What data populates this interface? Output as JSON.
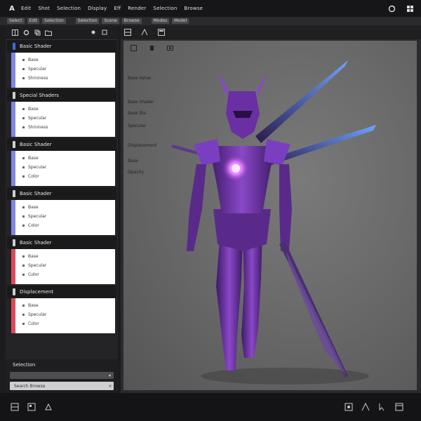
{
  "menubar": {
    "logo": "A",
    "items": [
      "Edit",
      "Shot",
      "Selection",
      "Display",
      "Eff",
      "Render",
      "Selection",
      "Browse"
    ]
  },
  "toolbar": {
    "items": [
      "Select",
      "Edit",
      "Selection",
      "Selection",
      "Scene",
      "Browse",
      "Modes",
      "Model"
    ]
  },
  "left_panel": {
    "sections": [
      {
        "title": "Basic Shader",
        "tag_color": "#3b6fe0",
        "stripe_color": "#7f88e0",
        "rows": [
          "Base",
          "Specular",
          "Shininess"
        ]
      },
      {
        "title": "Special Shaders",
        "tag_color": "#cfcfcf",
        "stripe_color": "#7f88e0",
        "rows": [
          "Base",
          "Specular",
          "Shininess"
        ]
      },
      {
        "title": "Basic Shader",
        "tag_color": "#cfcfcf",
        "stripe_color": "#7f88e0",
        "rows": [
          "Base",
          "Specular",
          "Color"
        ]
      },
      {
        "title": "Basic Shader",
        "tag_color": "#cfcfcf",
        "stripe_color": "#7f88e0",
        "rows": [
          "Base",
          "Specular",
          "Color"
        ]
      },
      {
        "title": "Basic Shader",
        "tag_color": "#cfcfcf",
        "stripe_color": "#d94a5a",
        "rows": [
          "Base",
          "Specular",
          "Color"
        ]
      },
      {
        "title": "Displacement",
        "tag_color": "#cfcfcf",
        "stripe_color": "#d94a5a",
        "rows": [
          "Base",
          "Specular",
          "Color"
        ]
      }
    ],
    "footer": {
      "title": "Selection",
      "bar_label": "",
      "search_label": "Search Browse",
      "search_close": "×"
    }
  },
  "viewport": {
    "properties": [
      "Base Value",
      "Base Shader",
      "Base Dis",
      "Specular",
      "Displacement",
      "Base",
      "Opacity"
    ]
  },
  "colors": {
    "accent": "#3b6fe0",
    "figure_main": "#6a2fa3",
    "figure_light": "#9b5ad6",
    "figure_glow": "#e8a2ff",
    "blade": "#4a7ad8"
  },
  "icons": {
    "menubar_right": [
      "refresh-icon",
      "grid-icon"
    ],
    "status": [
      "layers-icon",
      "grid-icon",
      "paint-icon",
      "settings-icon",
      "grid-icon",
      "cursor-icon",
      "window-icon"
    ]
  }
}
